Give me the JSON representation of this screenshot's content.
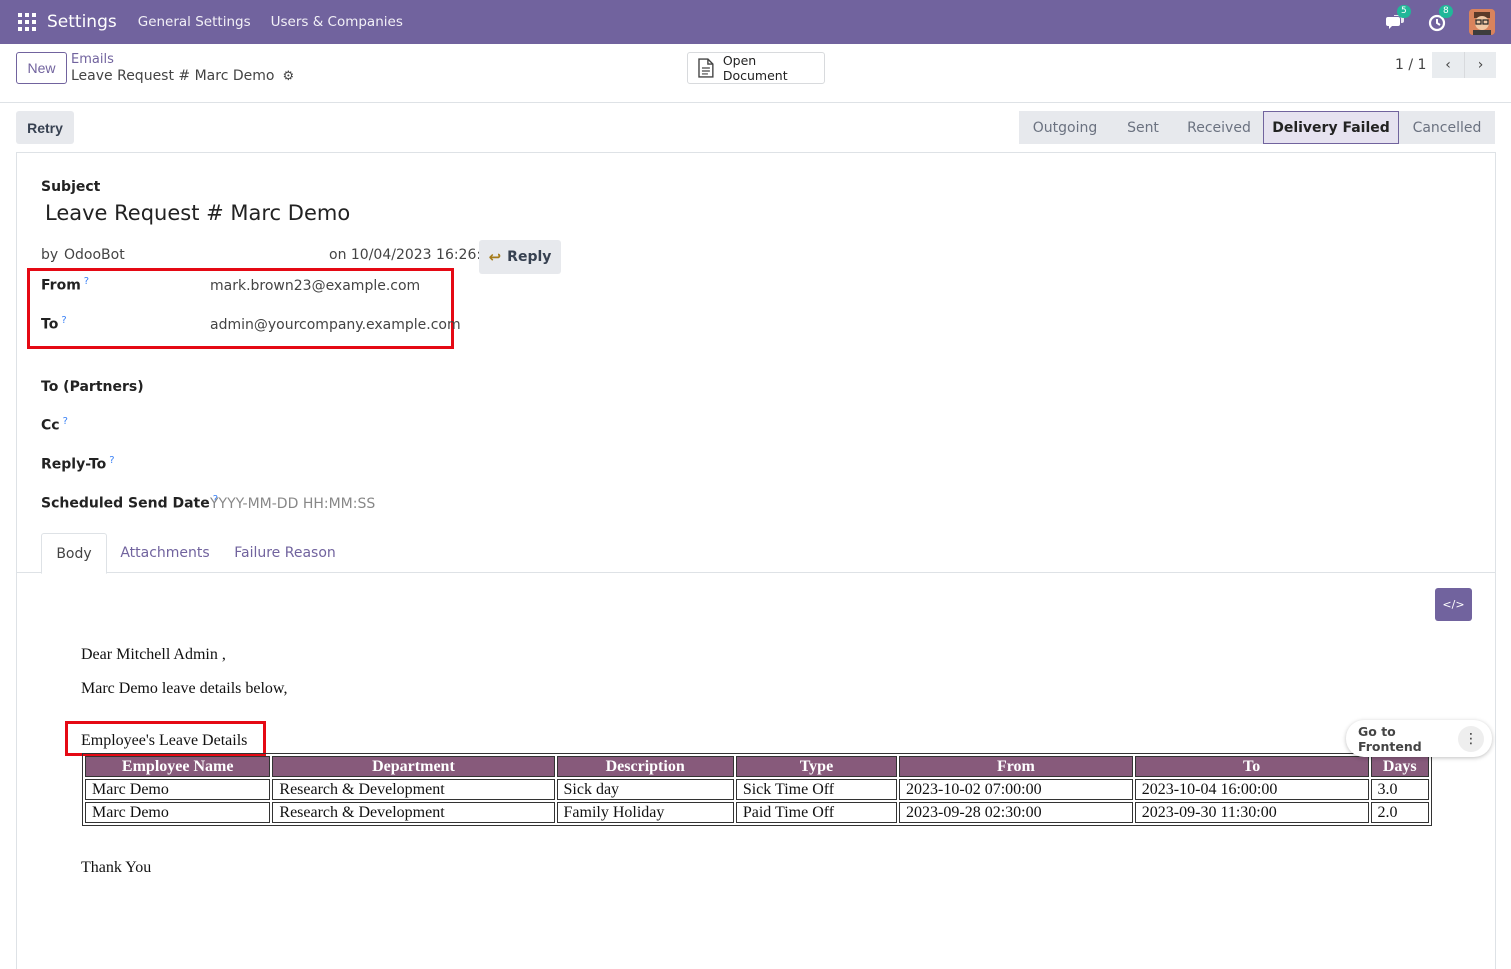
{
  "navbar": {
    "app_name": "Settings",
    "menu": [
      "General Settings",
      "Users & Companies"
    ],
    "messages_count": "5",
    "activities_count": "8"
  },
  "control_panel": {
    "new_label": "New",
    "breadcrumb_parent": "Emails",
    "breadcrumb_current": "Leave Request # Marc Demo",
    "open_document_label": "Open Document",
    "pager_value": "1 / 1"
  },
  "status": {
    "retry_label": "Retry",
    "stages": [
      "Outgoing",
      "Sent",
      "Received",
      "Delivery Failed",
      "Cancelled"
    ],
    "active_stage": "Delivery Failed"
  },
  "form": {
    "subject_label": "Subject",
    "subject": "Leave Request # Marc Demo",
    "by_label": "by",
    "author": "OdooBot",
    "date_text": "on 10/04/2023 16:26:45",
    "reply_label": "Reply",
    "from_label": "From",
    "from_value": "mark.brown23@example.com",
    "to_label": "To",
    "to_value": "admin@yourcompany.example.com",
    "to_partners_label": "To (Partners)",
    "cc_label": "Cc",
    "reply_to_label": "Reply-To",
    "scheduled_label": "Scheduled Send Date",
    "scheduled_placeholder": "YYYY-MM-DD HH:MM:SS",
    "help_mark": "?"
  },
  "tabs": [
    "Body",
    "Attachments",
    "Failure Reason"
  ],
  "body": {
    "greeting": "Dear Mitchell Admin ,",
    "intro": "Marc Demo leave details below,",
    "table_title": "Employee's Leave Details",
    "table_headers": [
      "Employee Name",
      "Department",
      "Description",
      "Type",
      "From",
      "To",
      "Days"
    ],
    "rows": [
      [
        "Marc Demo",
        "Research & Development",
        "Sick day",
        "Sick Time Off",
        "2023-10-02 07:00:00",
        "2023-10-04 16:00:00",
        "3.0"
      ],
      [
        "Marc Demo",
        "Research & Development",
        "Family Holiday",
        "Paid Time Off",
        "2023-09-28 02:30:00",
        "2023-09-30 11:30:00",
        "2.0"
      ]
    ],
    "closing": "Thank You"
  },
  "frontend": {
    "label": "Go to Frontend"
  },
  "colors": {
    "brand": "#71639e",
    "table_header": "#875a7b",
    "highlight": "#e50914"
  }
}
